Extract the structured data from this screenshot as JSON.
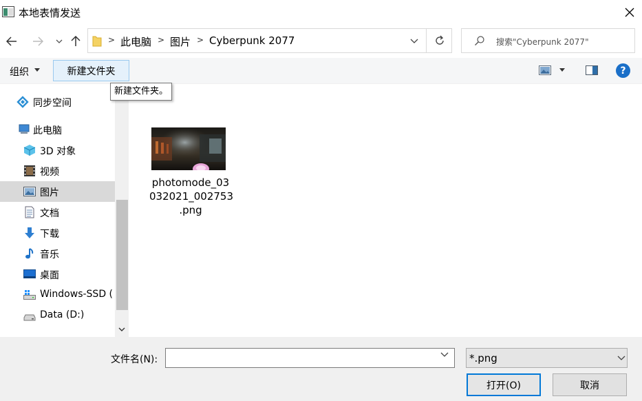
{
  "window": {
    "title": "本地表情发送",
    "app_icon": "window-app-icon",
    "close_icon": "close-icon"
  },
  "nav": {
    "back_icon": "back-arrow-icon",
    "forward_icon": "forward-arrow-icon",
    "recent_icon": "chevron-down-icon",
    "up_icon": "up-arrow-icon"
  },
  "address": {
    "breadcrumbs": [
      "此电脑",
      "图片",
      "Cyberpunk 2077"
    ],
    "separator": ">",
    "dropdown_icon": "chevron-down-icon",
    "refresh_icon": "refresh-icon"
  },
  "search": {
    "placeholder": "搜索\"Cyberpunk 2077\"",
    "icon": "search-icon"
  },
  "toolbar": {
    "organize_label": "组织",
    "new_folder_label": "新建文件夹",
    "view_icon": "view-options-icon",
    "pane_icon": "preview-pane-icon",
    "help_label": "?"
  },
  "tooltip": {
    "text": "新建文件夹。"
  },
  "sidebar": {
    "items": [
      {
        "label": "同步空间",
        "icon": "sync-space-icon"
      },
      {
        "label": "此电脑",
        "icon": "computer-icon"
      },
      {
        "label": "3D 对象",
        "icon": "3d-objects-icon"
      },
      {
        "label": "视频",
        "icon": "video-icon"
      },
      {
        "label": "图片",
        "icon": "pictures-icon",
        "selected": true
      },
      {
        "label": "文档",
        "icon": "documents-icon"
      },
      {
        "label": "下载",
        "icon": "download-icon"
      },
      {
        "label": "音乐",
        "icon": "music-icon"
      },
      {
        "label": "桌面",
        "icon": "desktop-icon"
      },
      {
        "label": "Windows-SSD (",
        "icon": "drive-c-icon"
      },
      {
        "label": "Data (D:)",
        "icon": "drive-d-icon"
      }
    ]
  },
  "files": [
    {
      "name_line1": "photomode_03",
      "name_line2": "032021_002753",
      "name_line3": ".png"
    }
  ],
  "footer": {
    "filename_label": "文件名(N):",
    "filename_value": "",
    "filetype_value": "*.png",
    "open_label": "打开(O)",
    "cancel_label": "取消"
  },
  "colors": {
    "accent": "#0078d7",
    "selected_bg": "#d9d9d9",
    "help_blue": "#1a6fc8"
  }
}
